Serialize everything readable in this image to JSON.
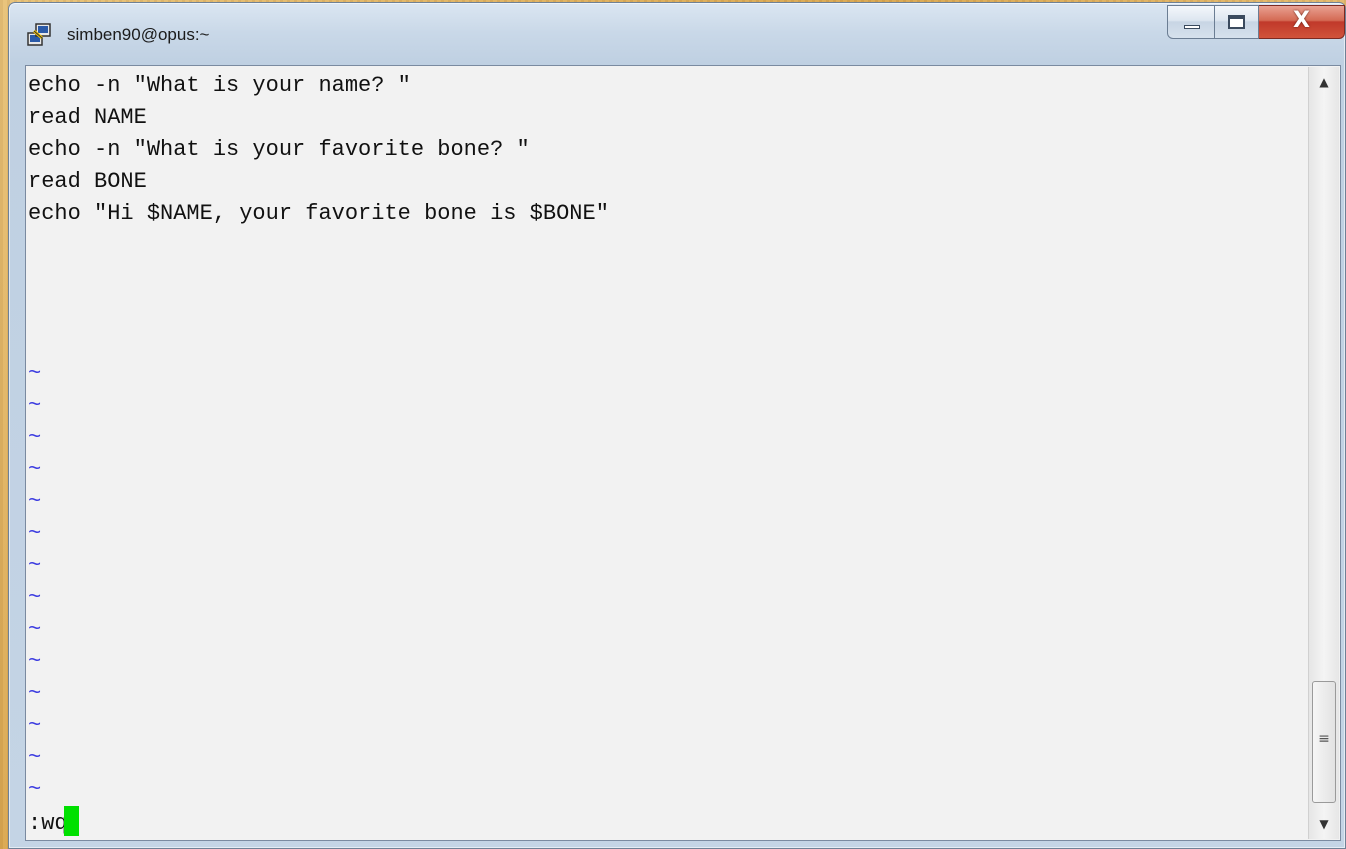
{
  "window": {
    "title": "simben90@opus:~",
    "app_icon": "putty-icon",
    "controls": {
      "minimize_icon": "minimize-icon",
      "maximize_icon": "maximize-icon",
      "close_label": "X"
    }
  },
  "editor": {
    "lines": [
      "echo -n \"What is your name? \"",
      "read NAME",
      "echo -n \"What is your favorite bone? \"",
      "read BONE",
      "echo \"Hi $NAME, your favorite bone is $BONE\""
    ],
    "tilde_char": "~",
    "tilde_count": 14,
    "command_line": ":wq",
    "cursor_color": "#00e000",
    "tilde_color": "#3a3ae0"
  },
  "scrollbar": {
    "up_icon": "scroll-up-arrow-icon",
    "down_icon": "scroll-down-arrow-icon",
    "grip_icon": "grip-icon",
    "up_glyph": "▲",
    "down_glyph": "▼",
    "grip_glyph": "≡"
  }
}
